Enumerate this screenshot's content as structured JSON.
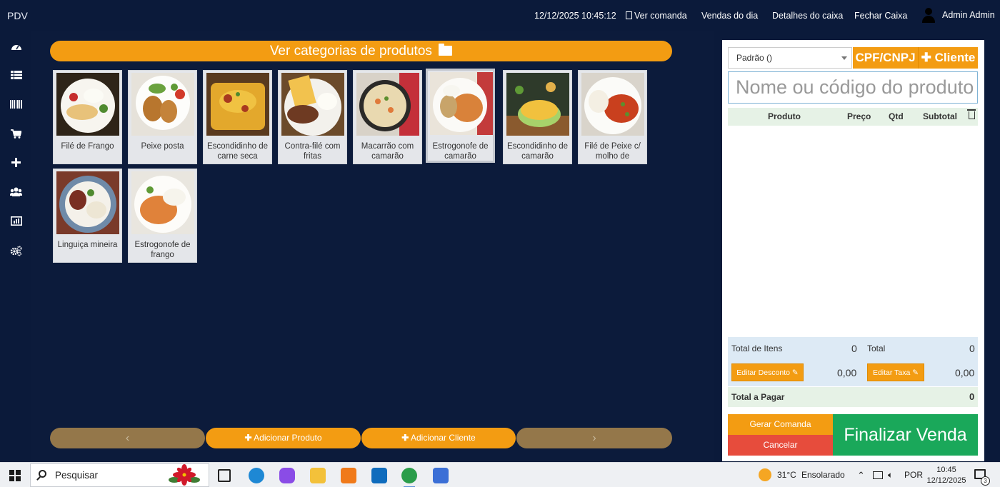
{
  "app": {
    "brand": "PDV"
  },
  "topbar": {
    "datetime": "12/12/2025 10:45:12",
    "ver_comanda": "Ver comanda",
    "vendas_do_dia": "Vendas do dia",
    "detalhes_do_caixa": "Detalhes do caixa",
    "fechar_caixa": "Fechar Caixa",
    "user": "Admin Admin"
  },
  "sidebar": {
    "items": [
      {
        "icon": "dashboard-icon"
      },
      {
        "icon": "table-icon"
      },
      {
        "icon": "barcode-icon"
      },
      {
        "icon": "cart-icon"
      },
      {
        "icon": "plus-icon"
      },
      {
        "icon": "users-icon"
      },
      {
        "icon": "chart-icon"
      },
      {
        "icon": "gears-icon"
      }
    ]
  },
  "main": {
    "categories_button": "Ver categorias de produtos",
    "products": [
      {
        "name": "Filé de Frango"
      },
      {
        "name": "Peixe posta"
      },
      {
        "name": "Escondidinho de carne seca"
      },
      {
        "name": "Contra-filé com fritas"
      },
      {
        "name": "Macarrão com camarão"
      },
      {
        "name": "Estrogonofe de camarão"
      },
      {
        "name": "Escondidinho de camarão"
      },
      {
        "name": "Filé de Peixe c/ molho de"
      },
      {
        "name": "Linguiça mineira"
      },
      {
        "name": "Estrogonofe de frango"
      }
    ],
    "nav": {
      "prev": "‹",
      "add_product": "Adicionar Produto",
      "add_client": "Adicionar Cliente",
      "next": "›"
    }
  },
  "cart": {
    "price_table_selected": "Padrão ()",
    "cpf_button": "CPF/CNPJ",
    "client_button": "Cliente",
    "search_placeholder": "Nome ou código do produto",
    "columns": {
      "produto": "Produto",
      "preco": "Preço",
      "qtd": "Qtd",
      "subtotal": "Subtotal"
    },
    "totals": {
      "total_itens_label": "Total de Itens",
      "total_itens": "0",
      "total_label": "Total",
      "total": "0",
      "editar_desconto": "Editar Desconto",
      "desconto": "0,00",
      "editar_taxa": "Editar Taxa",
      "taxa": "0,00",
      "total_pagar_label": "Total a Pagar",
      "total_pagar": "0"
    },
    "gerar_comanda": "Gerar Comanda",
    "cancelar": "Cancelar",
    "finalizar": "Finalizar Venda"
  },
  "taskbar": {
    "search": "Pesquisar",
    "weather_temp": "31°C",
    "weather_desc": "Ensolarado",
    "language": "POR",
    "time": "10:45",
    "date": "12/12/2025",
    "notifications": "3"
  },
  "colors": {
    "accent": "#f39c12",
    "success": "#1aa85a",
    "danger": "#e74c3c",
    "background": "#0b1a3a"
  }
}
